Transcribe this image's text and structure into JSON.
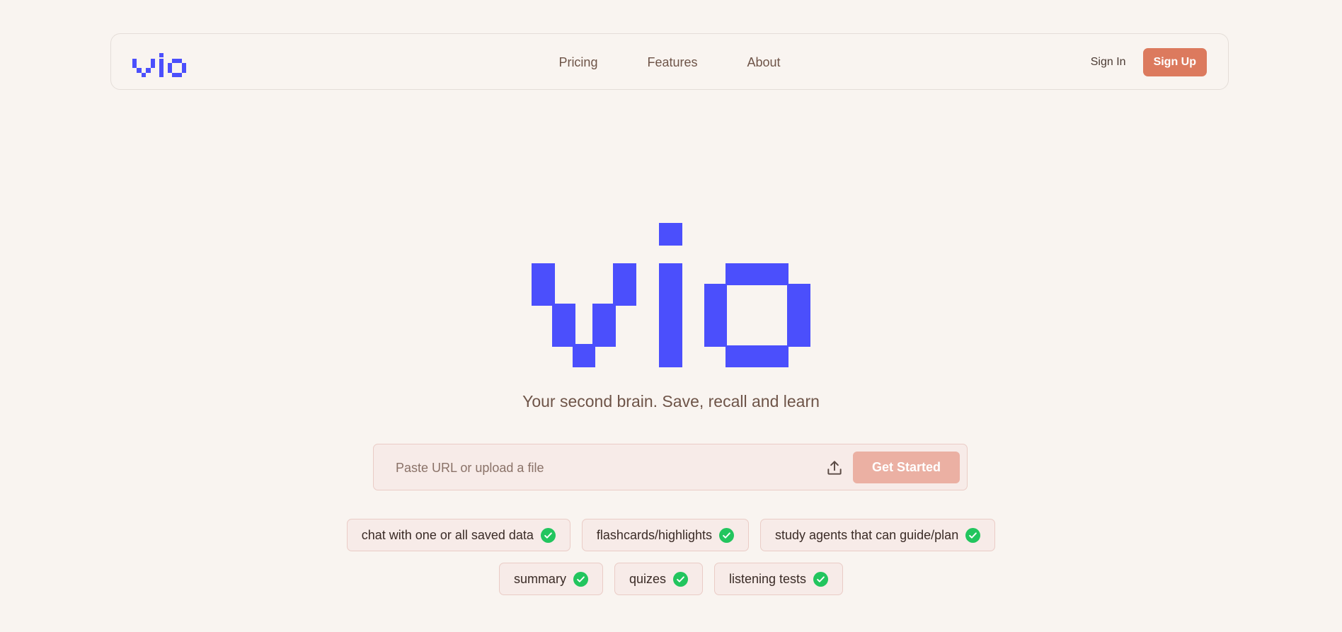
{
  "brand": {
    "name": "vio",
    "color": "#4b4ffc"
  },
  "nav": {
    "links": [
      "Pricing",
      "Features",
      "About"
    ],
    "sign_in": "Sign In",
    "sign_up": "Sign Up"
  },
  "hero": {
    "tagline": "Your second brain. Save, recall and learn"
  },
  "url_input": {
    "placeholder": "Paste URL or upload a file",
    "value": "",
    "upload_icon": "upload-icon",
    "submit_label": "Get Started"
  },
  "features": {
    "row1": [
      "chat with one or all saved data",
      "flashcards/highlights",
      "study agents that can guide/plan"
    ],
    "row2": [
      "summary",
      "quizes",
      "listening tests"
    ],
    "check_icon": "check-circle-icon",
    "check_color": "#22c55e"
  },
  "colors": {
    "background": "#f9f4f0",
    "accent": "#dc7a5e",
    "accent_muted": "#ebb0a3",
    "text_brown": "#6e5448"
  }
}
